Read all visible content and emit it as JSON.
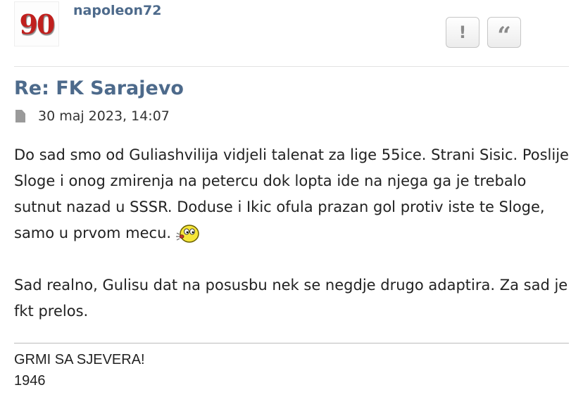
{
  "post": {
    "author": {
      "avatar_text": "90",
      "username": "napoleon72"
    },
    "actions": {
      "report_icon": "!",
      "quote_icon": "“"
    },
    "title": "Re: FK Sarajevo",
    "timestamp": "30 maj 2023, 14:07",
    "body": {
      "paragraph1": "Do sad smo od Guliashvilija vidjeli talenat za lige 55ice. Strani Sisic. Poslije Sloge i onog zmirenja na petercu dok lopta ide na njega ga je trebalo sutnut nazad u SSSR. Doduse i Ikic ofula prazan gol protiv iste te Sloge, samo u prvom mecu.",
      "paragraph2": "Sad realno, Gulisu dat na posusbu nek se negdje drugo adaptira. Za sad je fkt prelos."
    },
    "signature": {
      "line1": "GRMI SA SJEVERA!",
      "line2": "1946"
    }
  },
  "icons": {
    "post_icon": "document-icon",
    "emoji": "whistling-smiley-icon"
  },
  "colors": {
    "link": "#4d6a8b",
    "avatar_number": "#c0201e"
  }
}
